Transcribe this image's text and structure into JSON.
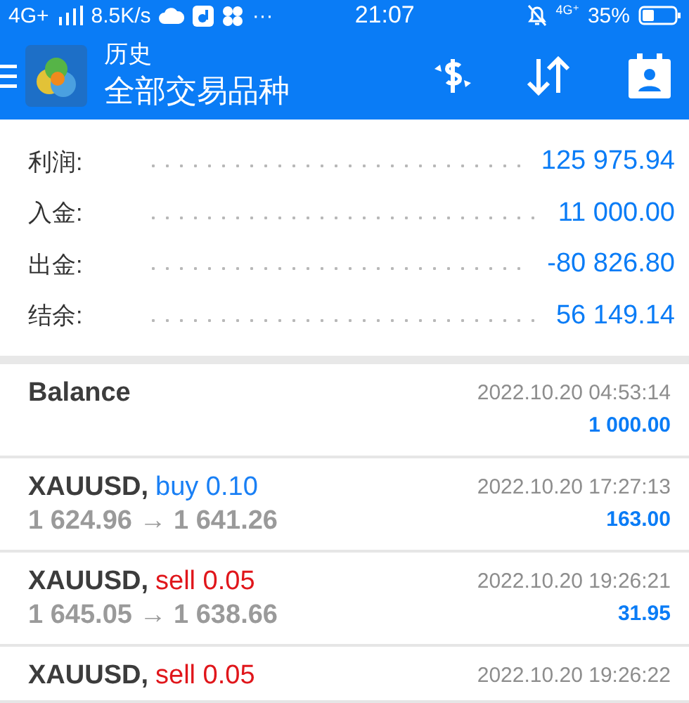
{
  "status_bar": {
    "network": "4G+",
    "speed": "8.5K/s",
    "more": "···",
    "time": "21:07",
    "network_right": "4G⁺",
    "battery": "35%"
  },
  "header": {
    "subtitle": "历史",
    "title": "全部交易品种"
  },
  "summary": [
    {
      "label": "利润:",
      "value": "125 975.94"
    },
    {
      "label": "入金:",
      "value": "11 000.00"
    },
    {
      "label": "出金:",
      "value": "-80 826.80"
    },
    {
      "label": "结余:",
      "value": "56 149.14"
    }
  ],
  "deals": [
    {
      "kind": "balance",
      "title": "Balance",
      "time": "2022.10.20 04:53:14",
      "amount": "1 000.00"
    },
    {
      "kind": "buy",
      "title": "XAUUSD,",
      "order": "buy 0.10",
      "prices": "1 624.96 → 1 641.26",
      "time": "2022.10.20 17:27:13",
      "amount": "163.00"
    },
    {
      "kind": "sell",
      "title": "XAUUSD,",
      "order": "sell 0.05",
      "prices": "1 645.05 → 1 638.66",
      "time": "2022.10.20 19:26:21",
      "amount": "31.95"
    },
    {
      "kind": "sell",
      "title": "XAUUSD,",
      "order": "sell 0.05",
      "time": "2022.10.20 19:26:22"
    }
  ]
}
